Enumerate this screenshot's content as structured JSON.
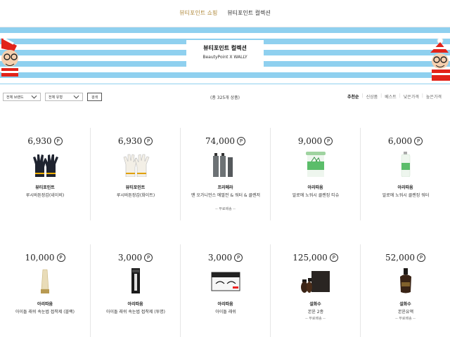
{
  "topnav": {
    "tabs": [
      {
        "label": "뷰티포인트 쇼핑",
        "active": true
      },
      {
        "label": "뷰티포인트 컬렉션",
        "active": false
      }
    ]
  },
  "banner": {
    "title": "뷰티포인트 컬렉션",
    "subtitle": "BeautyPoint X WALLY"
  },
  "filters": {
    "brand_select": "전체 브랜드",
    "type_select": "전체 유형",
    "search_label": "검색"
  },
  "count": "(총 325개 상품)",
  "sort": {
    "options": [
      "추천순",
      "신상품",
      "베스트",
      "낮은가격",
      "높은가격"
    ],
    "active": "추천순"
  },
  "point_symbol": "P",
  "products": [
    {
      "price": "6,930",
      "brand": "뷰티포인트",
      "name": "루시바튼장갑(네이비)",
      "ship": "",
      "icon": "navy-gloves"
    },
    {
      "price": "6,930",
      "brand": "뷰티포인트",
      "name": "루시바튼장갑(화이트)",
      "ship": "",
      "icon": "white-gloves"
    },
    {
      "price": "74,000",
      "brand": "프리메라",
      "name": "맨 오가니언스 에멀전 & 워터 & 클렌저",
      "ship": "-- 무료배송 --",
      "icon": "men-skincare-set"
    },
    {
      "price": "9,000",
      "brand": "아리따움",
      "name": "알로에 노워시 클렌징 티슈",
      "ship": "",
      "icon": "aloe-tissue-tub"
    },
    {
      "price": "6,000",
      "brand": "아리따움",
      "name": "알로에 노워시 클렌징 워터",
      "ship": "",
      "icon": "aloe-water-bottle"
    },
    {
      "price": "10,000",
      "brand": "아리따움",
      "name": "아이돌 래쉬 속눈썹 접착제 (블랙)",
      "ship": "",
      "icon": "lash-glue-tube"
    },
    {
      "price": "3,000",
      "brand": "아리따움",
      "name": "아이돌 래쉬 속눈썹 접착제 (투명)",
      "ship": "",
      "icon": "lash-glue-pack"
    },
    {
      "price": "3,000",
      "brand": "아리따움",
      "name": "아이돌 래쉬",
      "ship": "",
      "icon": "false-lashes"
    },
    {
      "price": "125,000",
      "brand": "설화수",
      "name": "본윤 2종",
      "ship": "-- 무료배송 --",
      "icon": "sulwhasoo-set"
    },
    {
      "price": "52,000",
      "brand": "설화수",
      "name": "본윤유액",
      "ship": "-- 무료배송 --",
      "icon": "sulwhasoo-bottle"
    }
  ]
}
